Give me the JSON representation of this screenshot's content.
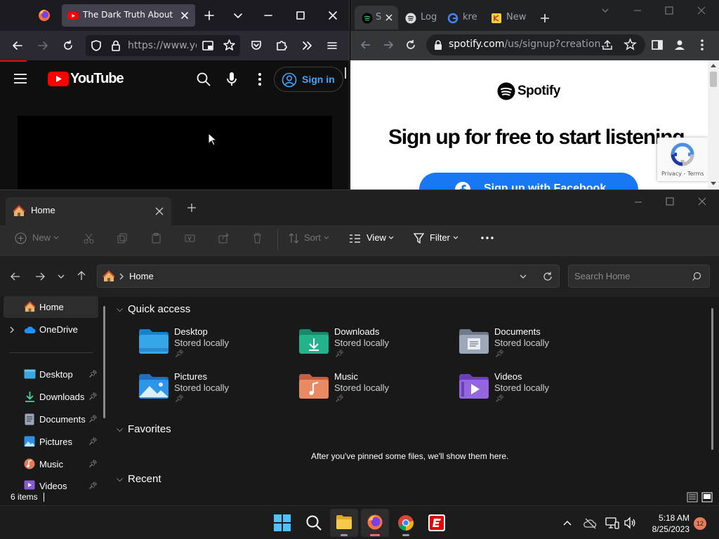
{
  "firefox": {
    "tab_title": "The Dark Truth About Rob",
    "url": "https://www.you",
    "youtube": {
      "logo_text": "YouTube",
      "signin_label": "Sign in"
    }
  },
  "chrome": {
    "tabs": [
      {
        "label": "S"
      },
      {
        "label": "Log"
      },
      {
        "label": "kre"
      },
      {
        "label": "New"
      }
    ],
    "url_host": "spotify.com",
    "url_path": "/us/signup?creation...",
    "page": {
      "brand": "Spotify",
      "headline": "Sign up for free to start listening.",
      "facebook_button": "Sign up with Facebook",
      "recaptcha_text": "Privacy - Terms"
    }
  },
  "explorer": {
    "tab_title": "Home",
    "commands": {
      "new": "New",
      "sort": "Sort",
      "view": "View",
      "filter": "Filter"
    },
    "address": "Home",
    "search_placeholder": "Search Home",
    "nav": {
      "home": "Home",
      "onedrive": "OneDrive",
      "pinned": [
        "Desktop",
        "Downloads",
        "Documents",
        "Pictures",
        "Music",
        "Videos"
      ]
    },
    "sections": {
      "quick_access": "Quick access",
      "favorites": "Favorites",
      "recent": "Recent"
    },
    "quick_access": [
      {
        "name": "Desktop",
        "sub": "Stored locally"
      },
      {
        "name": "Downloads",
        "sub": "Stored locally"
      },
      {
        "name": "Documents",
        "sub": "Stored locally"
      },
      {
        "name": "Pictures",
        "sub": "Stored locally"
      },
      {
        "name": "Music",
        "sub": "Stored locally"
      },
      {
        "name": "Videos",
        "sub": "Stored locally"
      }
    ],
    "favorites_empty": "After you've pinned some files, we'll show them here.",
    "status": "6 items"
  },
  "taskbar": {
    "time": "5:18 AM",
    "date": "8/25/2023",
    "notification_count": "12"
  },
  "colors": {
    "youtube_red": "#ff0000",
    "youtube_link": "#3ea6ff",
    "facebook_blue": "#1877f2",
    "explorer_bg": "#191919"
  }
}
